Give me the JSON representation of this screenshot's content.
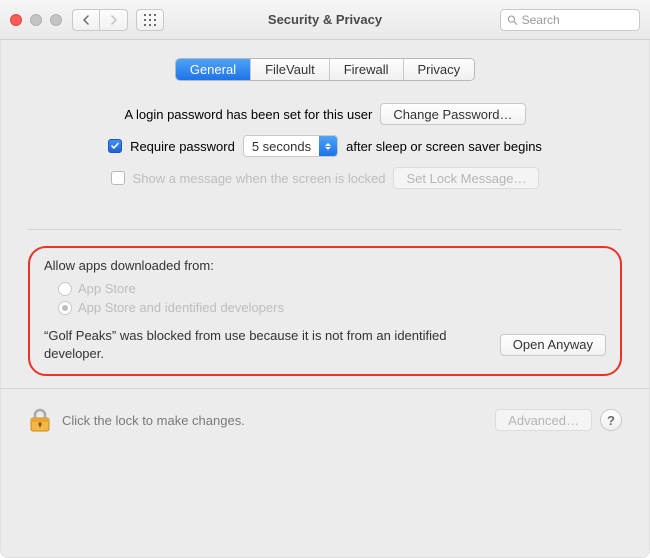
{
  "window": {
    "title": "Security & Privacy"
  },
  "search": {
    "placeholder": "Search"
  },
  "tabs": {
    "general": "General",
    "filevault": "FileVault",
    "firewall": "Firewall",
    "privacy": "Privacy"
  },
  "general": {
    "login_password_text": "A login password has been set for this user",
    "change_password": "Change Password…",
    "require_password_label": "Require password",
    "require_password_delay": "5 seconds",
    "require_password_suffix": "after sleep or screen saver begins",
    "show_message_label": "Show a message when the screen is locked",
    "set_lock_message": "Set Lock Message…"
  },
  "allow": {
    "heading": "Allow apps downloaded from:",
    "option_app_store": "App Store",
    "option_identified": "App Store and identified developers",
    "blocked_text": "“Golf Peaks” was blocked from use because it is not from an identified developer.",
    "open_anyway": "Open Anyway"
  },
  "footer": {
    "lock_text": "Click the lock to make changes.",
    "advanced": "Advanced…",
    "help": "?"
  }
}
